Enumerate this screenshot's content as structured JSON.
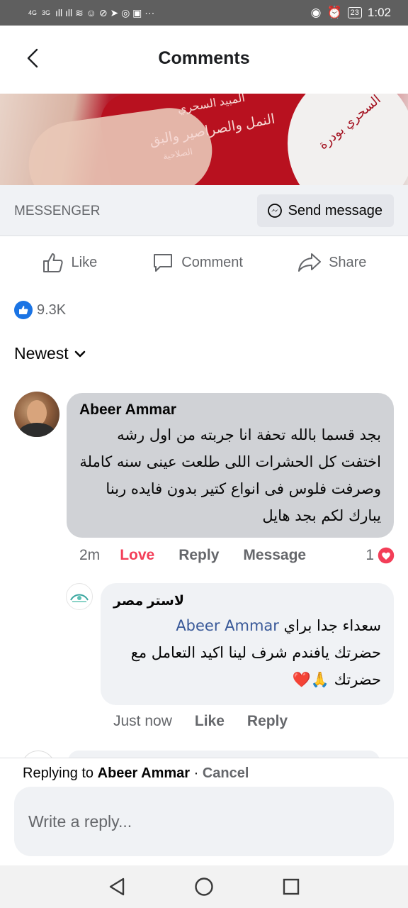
{
  "status_bar": {
    "net1": "4G",
    "net2": "3G",
    "left_glyphs": "ıll  ıll  ≋ ☺ ⊘ ➤ ◎ ▣ ···",
    "battery": "23",
    "time": "1:02"
  },
  "header": {
    "title": "Comments"
  },
  "post_image": {
    "text_line1": "المبيد السحري",
    "text_line2": "النمل والصراصير والبق",
    "text_line3": "الصلاحية",
    "lid_text": "السحري بودرة"
  },
  "messenger": {
    "label": "MESSENGER",
    "send_label": "Send message"
  },
  "actions": {
    "like": "Like",
    "comment": "Comment",
    "share": "Share"
  },
  "reactions": {
    "count": "9.3K"
  },
  "sort": {
    "label": "Newest"
  },
  "comment1": {
    "author": "Abeer Ammar",
    "text": "بجد قسما بالله تحفة انا جربته من اول رشه اختفت كل الحشرات اللى طلعت عينى سنه كاملة وصرفت فلوس فى انواع كتير بدون فايده   ربنا يبارك لكم بجد هايل",
    "time": "2m",
    "love": "Love",
    "reply": "Reply",
    "message": "Message",
    "reaction_count": "1"
  },
  "reply1": {
    "author": "لاستر مصر",
    "mention": "Abeer Ammar",
    "text_line1": "سعداء جدا براي",
    "text_rest": "حضرتك يافندم شرف لينا اكيد التعامل مع حضرتك",
    "emoji": "🙏❤️",
    "time": "Just now",
    "like": "Like",
    "reply": "Reply"
  },
  "composer": {
    "replying_prefix": "Replying to",
    "replying_name": "Abeer Ammar",
    "separator": "·",
    "cancel": "Cancel",
    "placeholder": "Write a reply..."
  },
  "colors": {
    "accent": "#1b74e4",
    "love": "#f33e58",
    "bubble": "#d0d2d6",
    "secondary_text": "#65676b"
  }
}
